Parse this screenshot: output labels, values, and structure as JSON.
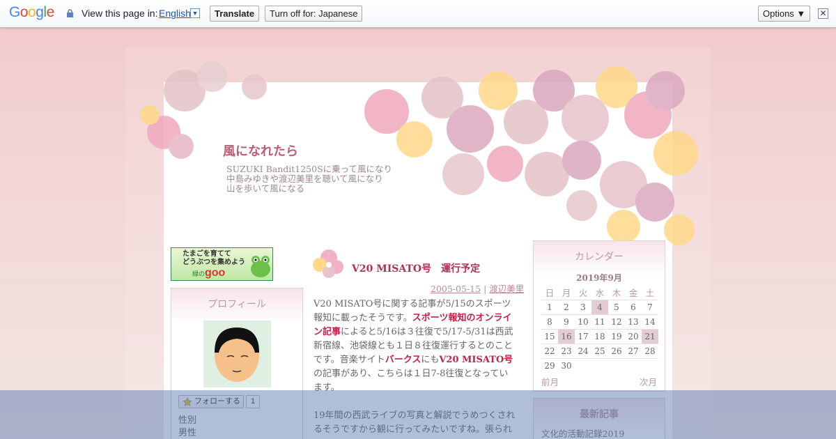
{
  "translate_bar": {
    "logo_letters": [
      "G",
      "o",
      "o",
      "g",
      "l",
      "e"
    ],
    "logo_colors": [
      "#4285f4",
      "#ea4335",
      "#fbbc05",
      "#4285f4",
      "#34a853",
      "#ea4335"
    ],
    "view_in_label": "View this page in:",
    "language": "English",
    "dropdown_glyph": "▼",
    "translate_button": "Translate",
    "turn_off_button": "Turn off for: Japanese",
    "options_button": "Options ▼",
    "close_glyph": "✕"
  },
  "blog": {
    "title": "風になれたら",
    "description": [
      "SUZUKI Bandit1250Sに乗って風になり",
      "中島みゆきや渡辺美里を聴いて風になり",
      "山を歩いて風になる"
    ],
    "accent_color": "#b95d72"
  },
  "banner": {
    "line1": "たまごを育てて",
    "line2": "どうぶつを集めよう",
    "brand_prefix": "緑の",
    "brand": "goo"
  },
  "profile": {
    "title": "プロフィール",
    "follow_label": "フォローする",
    "follow_count": "1",
    "gender_label": "性別",
    "gender_value": "男性"
  },
  "post": {
    "title": "V20 MISATO号　運行予定",
    "date": "2005-05-15",
    "separator": "|",
    "category": "渡辺美里",
    "p1": [
      {
        "t": "V20 MISATO号に関する記事が5/15のスポーツ報知に載ったそうです。"
      },
      {
        "t": "スポーツ報知のオンライン記事",
        "link": true
      },
      {
        "t": "によると5/16は３往復で5/17-5/31は西武新宿線、池袋線とも１日８往復運行するとのことです。音楽サイト"
      },
      {
        "t": "バークス",
        "link": true
      },
      {
        "t": "にも"
      },
      {
        "t": "V20 MISATO号",
        "link": true
      },
      {
        "t": "の記事があり、こちらは１日7-8往復となっています。"
      }
    ],
    "p2": "19年間の西武ライブの写真と解説でうめつくされるそうですから観に行ってみたいですね。張られ"
  },
  "calendar": {
    "title": "カレンダー",
    "month": "2019年9月",
    "weekdays": [
      "日",
      "月",
      "火",
      "水",
      "木",
      "金",
      "土"
    ],
    "weeks": [
      [
        "1",
        "2",
        "3",
        "4",
        "5",
        "6",
        "7"
      ],
      [
        "8",
        "9",
        "10",
        "11",
        "12",
        "13",
        "14"
      ],
      [
        "15",
        "16",
        "17",
        "18",
        "19",
        "20",
        "21"
      ],
      [
        "22",
        "23",
        "24",
        "25",
        "26",
        "27",
        "28"
      ],
      [
        "29",
        "30",
        "",
        "",
        "",
        "",
        ""
      ]
    ],
    "highlighted": [
      "4",
      "16",
      "21"
    ],
    "prev": "前月",
    "next": "次月"
  },
  "recent": {
    "title": "最新記事",
    "items": [
      "文化的活動記録2019"
    ]
  }
}
